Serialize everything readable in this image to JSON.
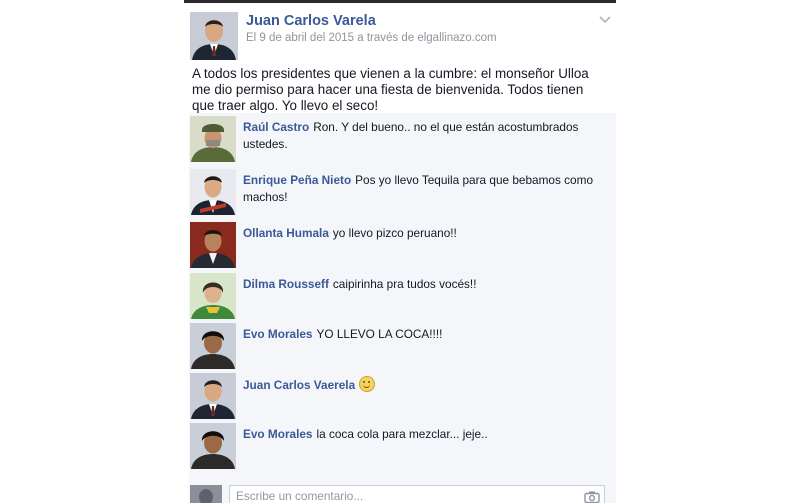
{
  "post": {
    "author": "Juan Carlos Varela",
    "meta": "El 9 de abril del 2015 a través de elgallinazo.com",
    "text": "A todos los presidentes que vienen a la cumbre: el monseñor Ulloa\nme dio permiso para hacer una fiesta de bienvenida.  Todos tienen\nque traer algo. Yo llevo el seco!"
  },
  "comments": [
    {
      "name": "Raúl Castro",
      "text": "Ron. Y del bueno.. no el que están acostumbrados ustedes."
    },
    {
      "name": "Enrique Peña Nieto",
      "text": "Pos yo llevo Tequila para que bebamos como machos!"
    },
    {
      "name": "Ollanta Humala",
      "text": "yo llevo pizco peruano!!"
    },
    {
      "name": "Dilma Rousseff",
      "text": "caipirinha pra tudos vocés!!"
    },
    {
      "name": "Evo Morales",
      "text": "YO LLEVO LA COCA!!!!"
    },
    {
      "name": "Juan Carlos Vaerela",
      "text": ""
    },
    {
      "name": "Evo Morales",
      "text": "la coca cola para mezclar... jeje.."
    }
  ],
  "composer": {
    "placeholder": "Escribe un comentario..."
  },
  "icons": {
    "post_menu": "chevron-down-icon",
    "emoji": "smiley-icon",
    "attach_photo": "camera-icon"
  },
  "colors": {
    "name_link": "#3b5998",
    "meta_text": "#90949c",
    "comments_background": "#f4f6fa"
  }
}
